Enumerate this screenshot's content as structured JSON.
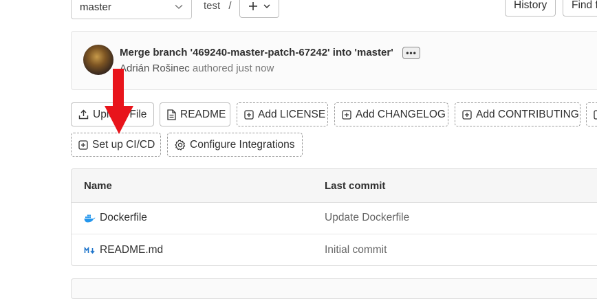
{
  "header": {
    "branch": "master",
    "breadcrumb_path": "test",
    "breadcrumb_sep": "/",
    "history_label": "History",
    "find_label": "Find f"
  },
  "commit": {
    "title": "Merge branch '469240-master-patch-67242' into 'master'",
    "author": "Adrián Rošinec",
    "authored_text": "authored just now"
  },
  "actions": {
    "upload_file": "Upload File",
    "readme": "README",
    "add_license": "Add LICENSE",
    "add_changelog": "Add CHANGELOG",
    "add_contributing": "Add CONTRIBUTING",
    "setup_cicd": "Set up CI/CD",
    "configure_integrations": "Configure Integrations"
  },
  "files_table": {
    "columns": [
      "Name",
      "Last commit"
    ],
    "rows": [
      {
        "name": "Dockerfile",
        "last_commit": "Update Dockerfile",
        "icon": "docker-icon"
      },
      {
        "name": "README.md",
        "last_commit": "Initial commit",
        "icon": "markdown-icon"
      }
    ]
  },
  "annotation": {
    "arrow_color": "#e8141b",
    "arrow_target": "setup-cicd-button"
  },
  "colors": {
    "docker_blue": "#2496ed",
    "markdown_blue": "#1f75cb",
    "text": "#303030",
    "muted": "#666666"
  }
}
